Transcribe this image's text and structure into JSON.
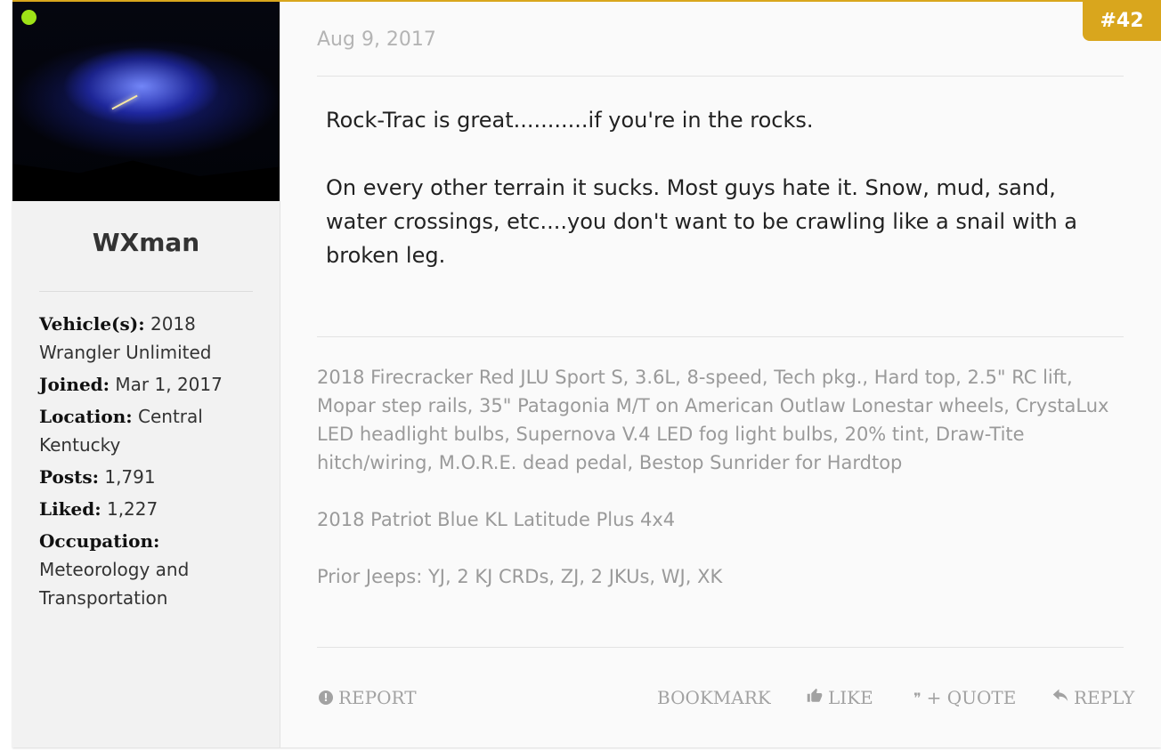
{
  "post": {
    "date": "Aug 9, 2017",
    "number": "#42",
    "message": [
      "Rock-Trac is great...........if you're in the rocks.",
      "On every other terrain it sucks. Most guys hate it. Snow, mud, sand, water crossings, etc....you don't want to be crawling like a snail with a broken leg."
    ],
    "signature": [
      "2018 Firecracker Red JLU Sport S, 3.6L, 8-speed, Tech pkg., Hard top, 2.5\" RC lift, Mopar step rails, 35\" Patagonia M/T on American Outlaw Lonestar wheels, CrystaLux LED headlight bulbs, Supernova V.4 LED fog light bulbs, 20% tint, Draw-Tite hitch/wiring, M.O.R.E. dead pedal, Bestop Sunrider for Hardtop",
      "2018 Patriot Blue KL Latitude Plus 4x4",
      "Prior Jeeps: YJ, 2 KJ CRDs, ZJ, 2 JKUs, WJ, XK"
    ],
    "accent_color": "#d9a61d"
  },
  "user": {
    "name": "WXman",
    "online_color": "#9ee217",
    "info": [
      {
        "label": "Vehicle(s):",
        "value": "2018 Wrangler Unlimited"
      },
      {
        "label": "Joined:",
        "value": "Mar 1, 2017"
      },
      {
        "label": "Location:",
        "value": "Central Kentucky"
      },
      {
        "label": "Posts:",
        "value": "1,791"
      },
      {
        "label": "Liked:",
        "value": "1,227"
      },
      {
        "label": "Occupation:",
        "value": "Meteorology and Transportation"
      }
    ]
  },
  "actions": {
    "report": {
      "label": "REPORT",
      "icon": "exclamation-circle-icon"
    },
    "bookmark": {
      "label": "BOOKMARK"
    },
    "like": {
      "label": "LIKE",
      "icon": "thumbs-up-icon"
    },
    "quote": {
      "label": "+ QUOTE",
      "icon": "quote-icon"
    },
    "reply": {
      "label": "REPLY",
      "icon": "reply-arrow-icon"
    }
  }
}
